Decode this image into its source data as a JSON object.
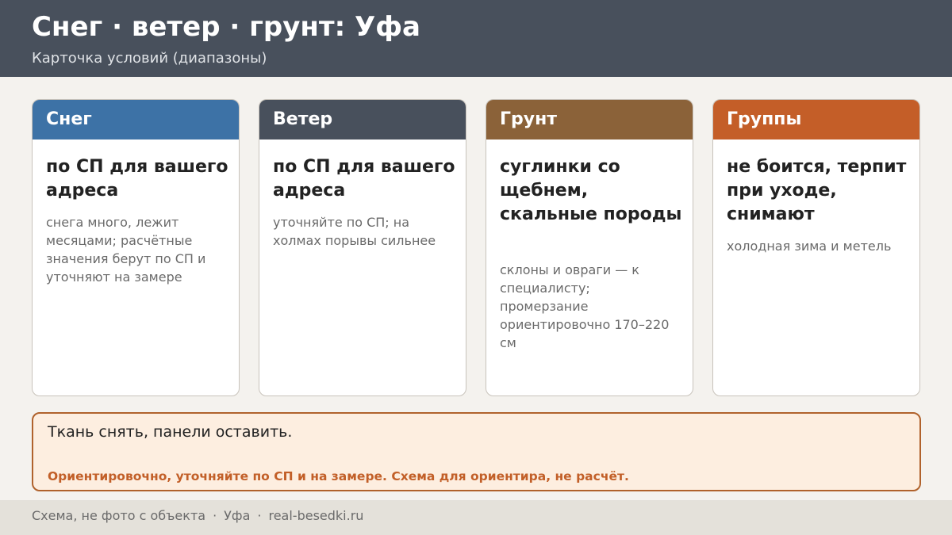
{
  "header": {
    "title": "Снег · ветер · грунт: Уфа",
    "subtitle": "Карточка условий (диапазоны)"
  },
  "cards": [
    {
      "label": "Снег",
      "color": "#3d72a6",
      "main": "по СП для вашего адреса",
      "note": "снега много, лежит месяцами; расчётные значения берут по СП и уточняют на замере"
    },
    {
      "label": "Ветер",
      "color": "#48505c",
      "main": "по СП для вашего адреса",
      "note": "уточняйте по СП; на холмах порывы сильнее"
    },
    {
      "label": "Грунт",
      "color": "#8b6239",
      "main": "суглинки со щебнем, скальные породы",
      "note": "склоны и овраги — к специалисту; промерзание ориентировочно 170–220 см"
    },
    {
      "label": "Группы",
      "color": "#c45e28",
      "main": "не боится, терпит при уходе, снимают",
      "note": "холодная зима и метель"
    }
  ],
  "note_box": {
    "main": "Ткань снять, панели оставить.",
    "warning": "Ориентировочно, уточняйте по СП и на замере. Схема для ориентира, не расчёт."
  },
  "footer": {
    "part1": "Схема, не фото с объекта",
    "separator": "·",
    "part2": "Уфа",
    "part3": "real-besedki.ru"
  }
}
